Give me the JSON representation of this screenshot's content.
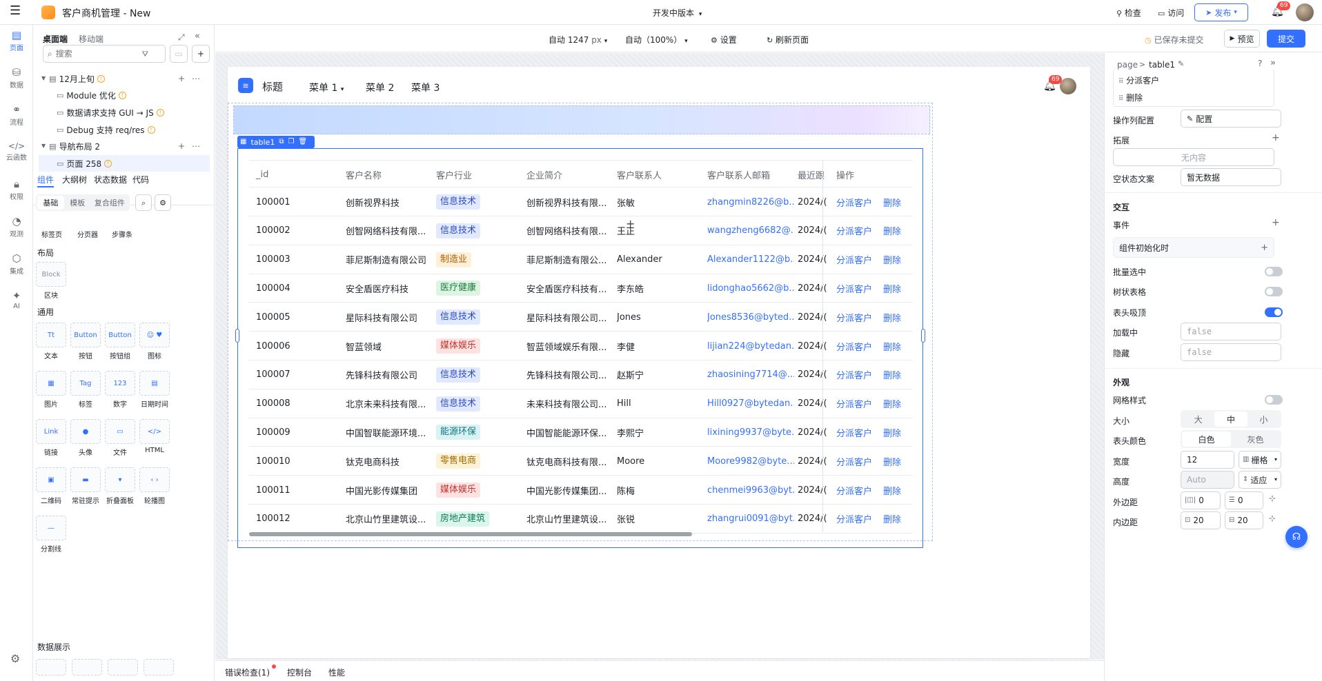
{
  "app": {
    "title": "客户商机管理 - New",
    "version": "开发中版本",
    "inspect": "检查",
    "visit": "访问",
    "publish": "发布",
    "notif_count": "69"
  },
  "rail": [
    {
      "label": "页面"
    },
    {
      "label": "数据"
    },
    {
      "label": "流程"
    },
    {
      "label": "云函数"
    },
    {
      "label": "权限"
    },
    {
      "label": "观测"
    },
    {
      "label": "集成"
    },
    {
      "label": "AI"
    }
  ],
  "left": {
    "tab_desktop": "桌面端",
    "tab_mobile": "移动端",
    "search_placeholder": "搜索",
    "tree": [
      {
        "label": "12月上旬"
      },
      {
        "label": "Module 优化"
      },
      {
        "label": "数据请求支持 GUI → JS"
      },
      {
        "label": "Debug 支持 req/res"
      },
      {
        "label": "导航布局 2"
      },
      {
        "label": "页面 258"
      }
    ],
    "tabs": [
      "组件",
      "大纲树",
      "状态数据",
      "代码"
    ],
    "sub_tabs": [
      "基础",
      "模板",
      "复合组件"
    ],
    "partial": [
      "标签页",
      "分页器",
      "步骤条"
    ],
    "layout_title": "布局",
    "block": {
      "thumb": "Block",
      "label": "区块"
    },
    "general_title": "通用",
    "components": [
      {
        "thumb": "Tt",
        "label": "文本"
      },
      {
        "thumb": "Button",
        "label": "按钮"
      },
      {
        "thumb": "Button",
        "label": "按钮组"
      },
      {
        "thumb": "☺ ♥",
        "label": "图标"
      },
      {
        "thumb": "▦",
        "label": "图片"
      },
      {
        "thumb": "Tag",
        "label": "标签"
      },
      {
        "thumb": "123",
        "label": "数字"
      },
      {
        "thumb": "▤",
        "label": "日期时间"
      },
      {
        "thumb": "Link",
        "label": "链接"
      },
      {
        "thumb": "●",
        "label": "头像"
      },
      {
        "thumb": "▭",
        "label": "文件"
      },
      {
        "thumb": "</>",
        "label": "HTML"
      },
      {
        "thumb": "▣",
        "label": "二维码"
      },
      {
        "thumb": "▬",
        "label": "常驻提示"
      },
      {
        "thumb": "▾",
        "label": "折叠面板"
      },
      {
        "thumb": "‹ ›",
        "label": "轮播图"
      },
      {
        "thumb": "—",
        "label": "分割线"
      }
    ],
    "data_title": "数据展示"
  },
  "toolbar": {
    "width": "自动 1247",
    "unit": "px",
    "zoom": "自动（100%）",
    "settings": "设置",
    "refresh": "刷新页面",
    "saved": "已保存未提交",
    "preview": "预览",
    "submit": "提交"
  },
  "preview": {
    "title": "标题",
    "menus": [
      "菜单 1",
      "菜单 2",
      "菜单 3"
    ],
    "notif_count": "69",
    "component_label": "table1"
  },
  "table": {
    "columns": [
      "_id",
      "客户名称",
      "客户行业",
      "企业简介",
      "客户联系人",
      "客户联系人邮箱",
      "最近跟",
      "操作"
    ],
    "action_assign": "分派客户",
    "action_delete": "删除",
    "rows": [
      {
        "id": "100001",
        "name": "创新视界科技",
        "industry": "信息技术",
        "intro": "创新视界科技有限...",
        "contact": "张敏",
        "email": "zhangmin8226@b...",
        "recent": "2024/("
      },
      {
        "id": "100002",
        "name": "创智网络科技有限...",
        "industry": "信息技术",
        "intro": "创智网络科技有限...",
        "contact": "王正",
        "email": "wangzheng6682@...",
        "recent": "2024/("
      },
      {
        "id": "100003",
        "name": "菲尼斯制造有限公司",
        "industry": "制造业",
        "intro": "菲尼斯制造有限公...",
        "contact": "Alexander",
        "email": "Alexander1122@b...",
        "recent": "2024/("
      },
      {
        "id": "100004",
        "name": "安全盾医疗科技",
        "industry": "医疗健康",
        "intro": "安全盾医疗科技有...",
        "contact": "李东皓",
        "email": "lidonghao5662@b...",
        "recent": "2024/("
      },
      {
        "id": "100005",
        "name": "星际科技有限公司",
        "industry": "信息技术",
        "intro": "星际科技有限公司...",
        "contact": "Jones",
        "email": "Jones8536@byted...",
        "recent": "2024/("
      },
      {
        "id": "100006",
        "name": "智蓝领域",
        "industry": "媒体娱乐",
        "intro": "智蓝领域娱乐有限...",
        "contact": "李健",
        "email": "lijian224@bytedan...",
        "recent": "2024/("
      },
      {
        "id": "100007",
        "name": "先锋科技有限公司",
        "industry": "信息技术",
        "intro": "先锋科技有限公司...",
        "contact": "赵斯宁",
        "email": "zhaosining7714@...",
        "recent": "2024/("
      },
      {
        "id": "100008",
        "name": "北京未来科技有限...",
        "industry": "信息技术",
        "intro": "未来科技有限公司...",
        "contact": "Hill",
        "email": "Hill0927@bytedan...",
        "recent": "2024/("
      },
      {
        "id": "100009",
        "name": "中国智联能源环境...",
        "industry": "能源环保",
        "intro": "中国智能能源环保...",
        "contact": "李熙宁",
        "email": "lixining9937@byte...",
        "recent": "2024/("
      },
      {
        "id": "100010",
        "name": "钛克电商科技",
        "industry": "零售电商",
        "intro": "钛克电商科技有限...",
        "contact": "Moore",
        "email": "Moore9982@byte...",
        "recent": "2024/("
      },
      {
        "id": "100011",
        "name": "中国光影传媒集团",
        "industry": "媒体娱乐",
        "intro": "中国光影传媒集团...",
        "contact": "陈梅",
        "email": "chenmei9963@byt...",
        "recent": "2024/("
      },
      {
        "id": "100012",
        "name": "北京山竹里建筑设...",
        "industry": "房地产建筑",
        "intro": "北京山竹里建筑设...",
        "contact": "张锐",
        "email": "zhangrui0091@byt...",
        "recent": "2024/("
      }
    ]
  },
  "industry_colors": {
    "信息技术": {
      "bg": "#e0e9ff",
      "fg": "#2b4acb"
    },
    "制造业": {
      "bg": "#fdefd8",
      "fg": "#b35f00"
    },
    "医疗健康": {
      "bg": "#dcf5e3",
      "fg": "#1f7a3d"
    },
    "媒体娱乐": {
      "bg": "#fde2e2",
      "fg": "#c4302b"
    },
    "能源环保": {
      "bg": "#d9f3f5",
      "fg": "#10747d"
    },
    "零售电商": {
      "bg": "#fdf2d6",
      "fg": "#a06a00"
    },
    "房地产建筑": {
      "bg": "#d9f5ec",
      "fg": "#0e7a57"
    }
  },
  "right": {
    "breadcrumb_page": "page",
    "breadcrumb_sep": ">",
    "breadcrumb_comp": "table1",
    "list_items": [
      "分派客户",
      "删除"
    ],
    "op_col_label": "操作列配置",
    "op_col_btn": "配置",
    "extend_label": "拓展",
    "extend_empty": "无内容",
    "empty_text_label": "空状态文案",
    "empty_text_value": "暂无数据",
    "interact_title": "交互",
    "event_label": "事件",
    "event_item": "组件初始化时",
    "batch_label": "批量选中",
    "tree_label": "树状表格",
    "sticky_label": "表头吸顶",
    "loading_label": "加载中",
    "loading_value": "false",
    "hidden_label": "隐藏",
    "hidden_value": "false",
    "appearance_title": "外观",
    "grid_label": "网格样式",
    "size_label": "大小",
    "size_opts": [
      "大",
      "中",
      "小"
    ],
    "header_color_label": "表头颜色",
    "header_color_opts": [
      "白色",
      "灰色"
    ],
    "width_label": "宽度",
    "width_value": "12",
    "width_unit": "栅格",
    "height_label": "高度",
    "height_value": "Auto",
    "height_unit": "适应",
    "margin_label": "外边距",
    "margin_h": "0",
    "margin_v": "0",
    "padding_label": "内边距",
    "padding_h": "20",
    "padding_v": "20"
  },
  "bottom": {
    "errors": "错误检查(1)",
    "console": "控制台",
    "perf": "性能"
  }
}
